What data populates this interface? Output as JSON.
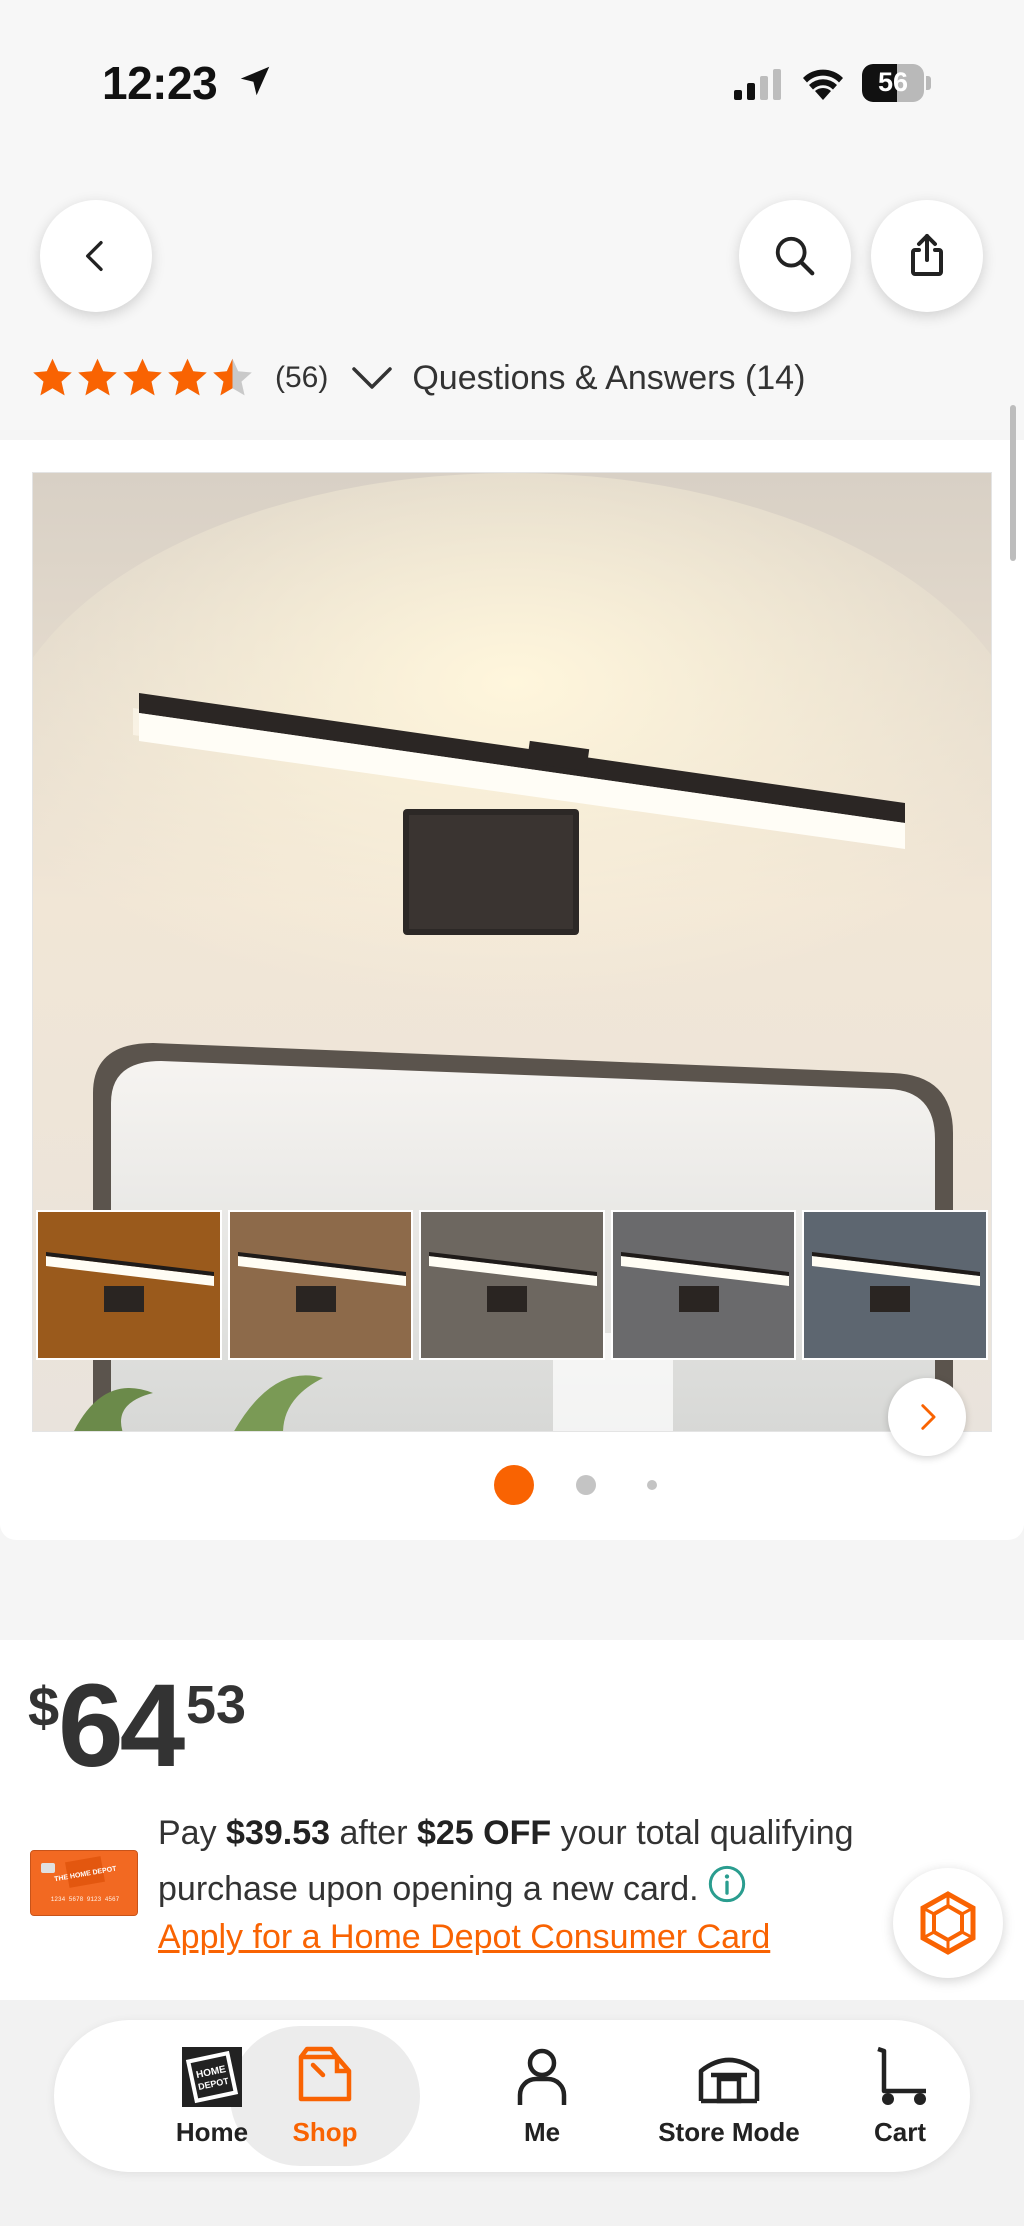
{
  "status_bar": {
    "time": "12:23",
    "battery": "56",
    "battery_level": 0.56
  },
  "header": {
    "rating_value": 4.5,
    "review_count": "(56)",
    "qa_link": "Questions & Answers (14)"
  },
  "gallery": {
    "dot_count": 3,
    "active_dot": 0,
    "swatch_colors": [
      "#9a5a1c",
      "#8d6a4a",
      "#6d6760",
      "#6a6a6c",
      "#5d6670"
    ]
  },
  "price": {
    "symbol": "$",
    "dollars": "64",
    "cents": "53"
  },
  "promo": {
    "pay": "Pay ",
    "amount": "$39.53",
    "after": " after ",
    "discount": "$25 OFF",
    "rest": " your total qualifying purchase upon opening a new card.",
    "apply_link": "Apply for a Home Depot Consumer Card",
    "card_logo_text": "THE HOME DEPOT",
    "card_number_text": "1234 5678 9123 4567"
  },
  "nav": {
    "tabs": [
      {
        "label": "Home",
        "icon": "home-depot-logo-icon"
      },
      {
        "label": "Shop",
        "icon": "shop-bag-icon"
      },
      {
        "label": "Me",
        "icon": "person-icon"
      },
      {
        "label": "Store Mode",
        "icon": "store-icon"
      },
      {
        "label": "Cart",
        "icon": "cart-icon"
      }
    ],
    "active_tab": "Shop"
  },
  "colors": {
    "brand_orange": "#f96302",
    "star_orange": "#f96302",
    "text_dark": "#222222"
  }
}
